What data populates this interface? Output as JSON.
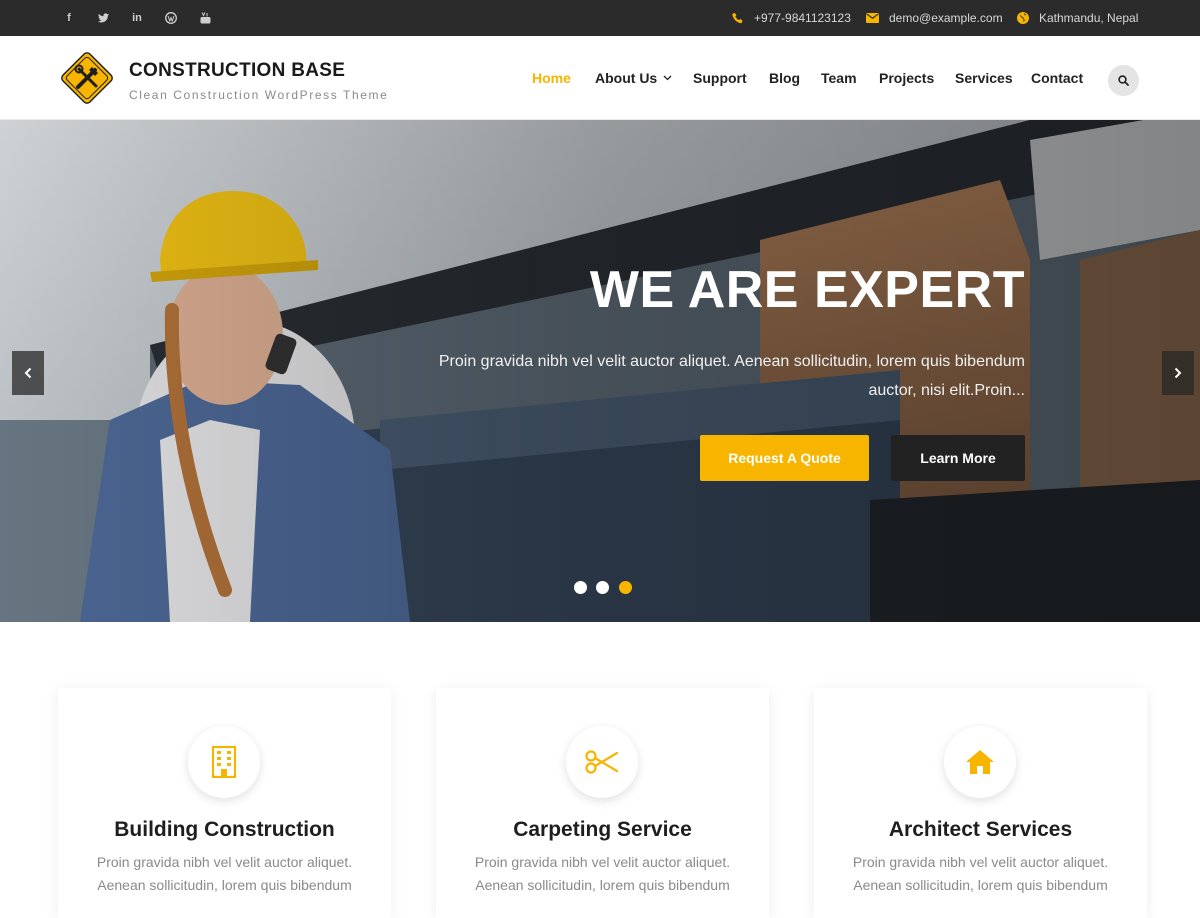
{
  "topbar": {
    "social": [
      "facebook-icon",
      "twitter-icon",
      "linkedin-icon",
      "wordpress-icon",
      "youtube-icon"
    ],
    "phone": "+977-9841123123",
    "email": "demo@example.com",
    "location": "Kathmandu, Nepal"
  },
  "header": {
    "title": "CONSTRUCTION BASE",
    "tagline": "Clean Construction WordPress Theme",
    "nav": [
      "Home",
      "About Us",
      "Support",
      "Blog",
      "Team",
      "Projects",
      "Services",
      "Contact"
    ],
    "active_nav": "Home"
  },
  "hero": {
    "title": "WE ARE EXPERT",
    "text": "Proin gravida nibh vel velit auctor aliquet. Aenean sollicitudin, lorem quis bibendum auctor, nisi elit.Proin...",
    "primary_button": "Request A Quote",
    "secondary_button": "Learn More",
    "slides": 3,
    "active_slide": 3
  },
  "services": [
    {
      "icon": "building-icon",
      "title": "Building Construction",
      "text": "Proin gravida nibh vel velit auctor aliquet. Aenean sollicitudin, lorem quis bibendum"
    },
    {
      "icon": "scissors-icon",
      "title": "Carpeting Service",
      "text": "Proin gravida nibh vel velit auctor aliquet. Aenean sollicitudin, lorem quis bibendum"
    },
    {
      "icon": "home-icon",
      "title": "Architect Services",
      "text": "Proin gravida nibh vel velit auctor aliquet. Aenean sollicitudin, lorem quis bibendum"
    }
  ],
  "colors": {
    "accent": "#f7b500",
    "dark": "#2b2b2b",
    "button_dark": "#222222"
  }
}
